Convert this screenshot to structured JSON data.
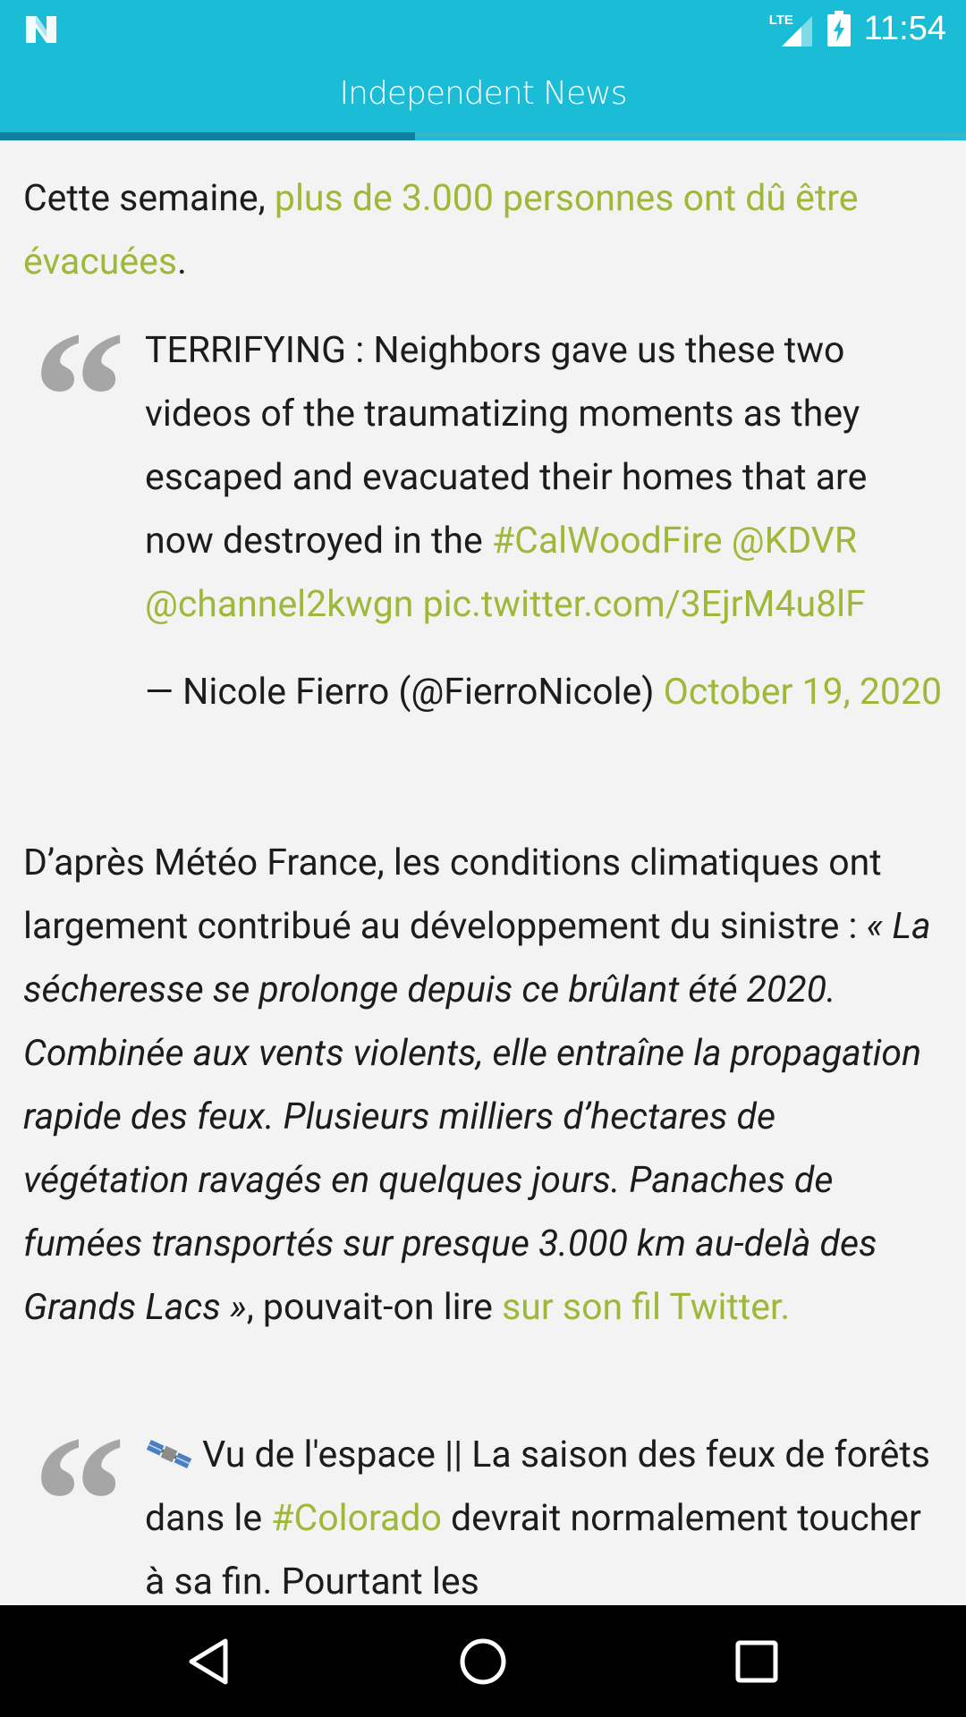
{
  "status_bar": {
    "network": "LTE",
    "time": "11:54",
    "icons": [
      "app-n-icon",
      "lte-signal-icon",
      "battery-charging-icon"
    ]
  },
  "app_bar": {
    "title": "Independent News",
    "progress_fraction": 0.43
  },
  "article": {
    "para1": {
      "before": "Cette semaine, ",
      "link": "plus de 3.000 personnes ont dû être évacuées",
      "after": "."
    },
    "quote1": {
      "text_before": "TERRIFYING : Neighbors gave us these two videos of the traumatizing moments as they escaped and evacuated their homes that are now destroyed in the ",
      "hashtag": "#CalWoodFire",
      "mention1": "@KDVR",
      "mention2": "@channel2kwgn",
      "pic_link": "pic.twitter.com/3EjrM4u8lF",
      "attribution": "— Nicole Fierro (@FierroNicole) ",
      "date_link": "October 19, 2020"
    },
    "para2": {
      "before": "D’après Météo France, les conditions climatiques ont largement contribué au développement du sinistre : ",
      "quote_italic": "« La sécheresse se prolonge depuis ce brûlant été 2020. Combinée aux vents violents, elle entraîne la propagation rapide des feux. Plusieurs milliers d’hectares de végétation ravagés en quelques jours. Panaches de fumées transportés sur presque 3.000 km au-delà des Grands Lacs »",
      "after": ", pouvait-on lire ",
      "link": "sur son fil Twitter."
    },
    "quote2": {
      "icon": "satellite-icon",
      "text_before": " Vu de l'espace || La saison des feux de forêts dans le ",
      "hashtag": "#Colorado",
      "text_after": " devrait normalement toucher à sa fin. Pourtant les"
    }
  },
  "nav_bar": {
    "buttons": [
      "back-icon",
      "home-icon",
      "recents-icon"
    ]
  },
  "colors": {
    "teal": "#1bbcd6",
    "progress": "#0f7fa4",
    "link": "#9fb83a"
  }
}
